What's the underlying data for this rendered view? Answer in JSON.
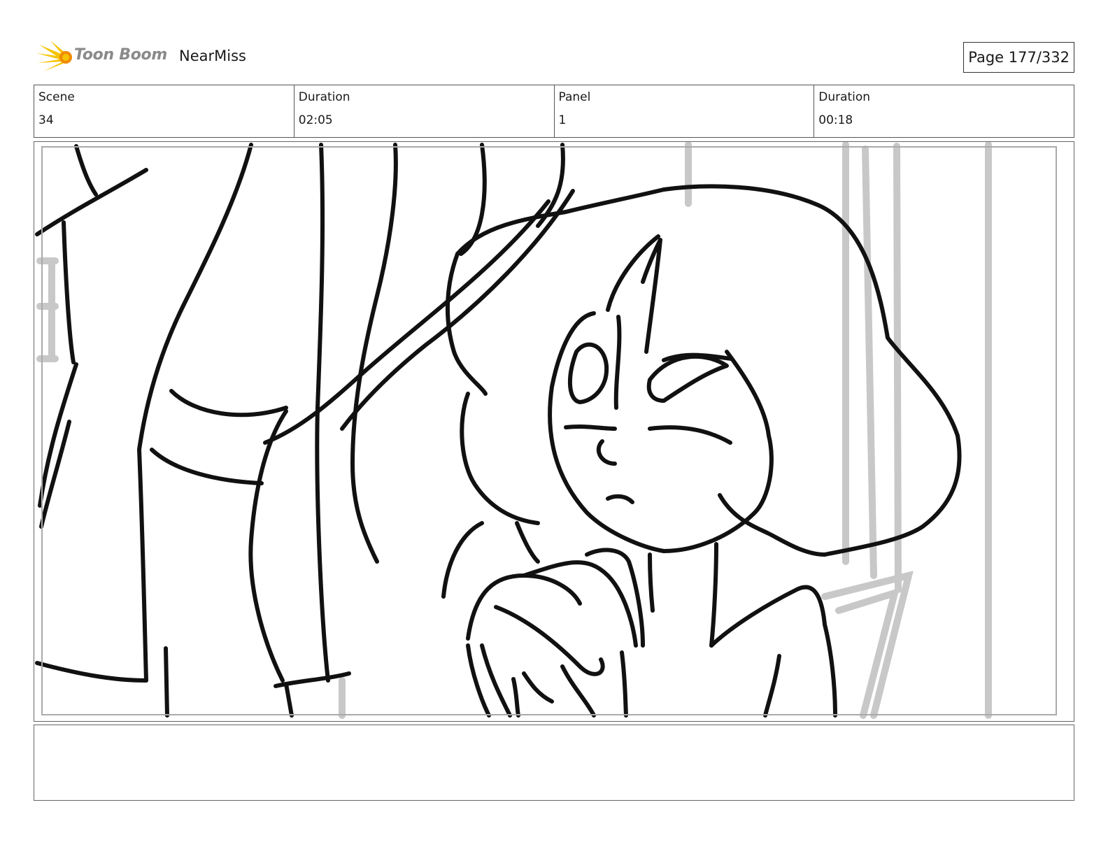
{
  "header": {
    "logo_text": "Toon Boom",
    "project_name": "NearMiss",
    "page_label": "Page 177/332"
  },
  "info": {
    "scene_label": "Scene",
    "scene_value": "34",
    "scene_duration_label": "Duration",
    "scene_duration_value": "02:05",
    "panel_label": "Panel",
    "panel_value": "1",
    "panel_duration_label": "Duration",
    "panel_duration_value": "00:18"
  },
  "colors": {
    "logo_yellow": "#f5c400",
    "logo_orange": "#f08a00",
    "ink": "#111111",
    "background_sketch": "#c8c8c8"
  },
  "notes": {
    "text": ""
  }
}
